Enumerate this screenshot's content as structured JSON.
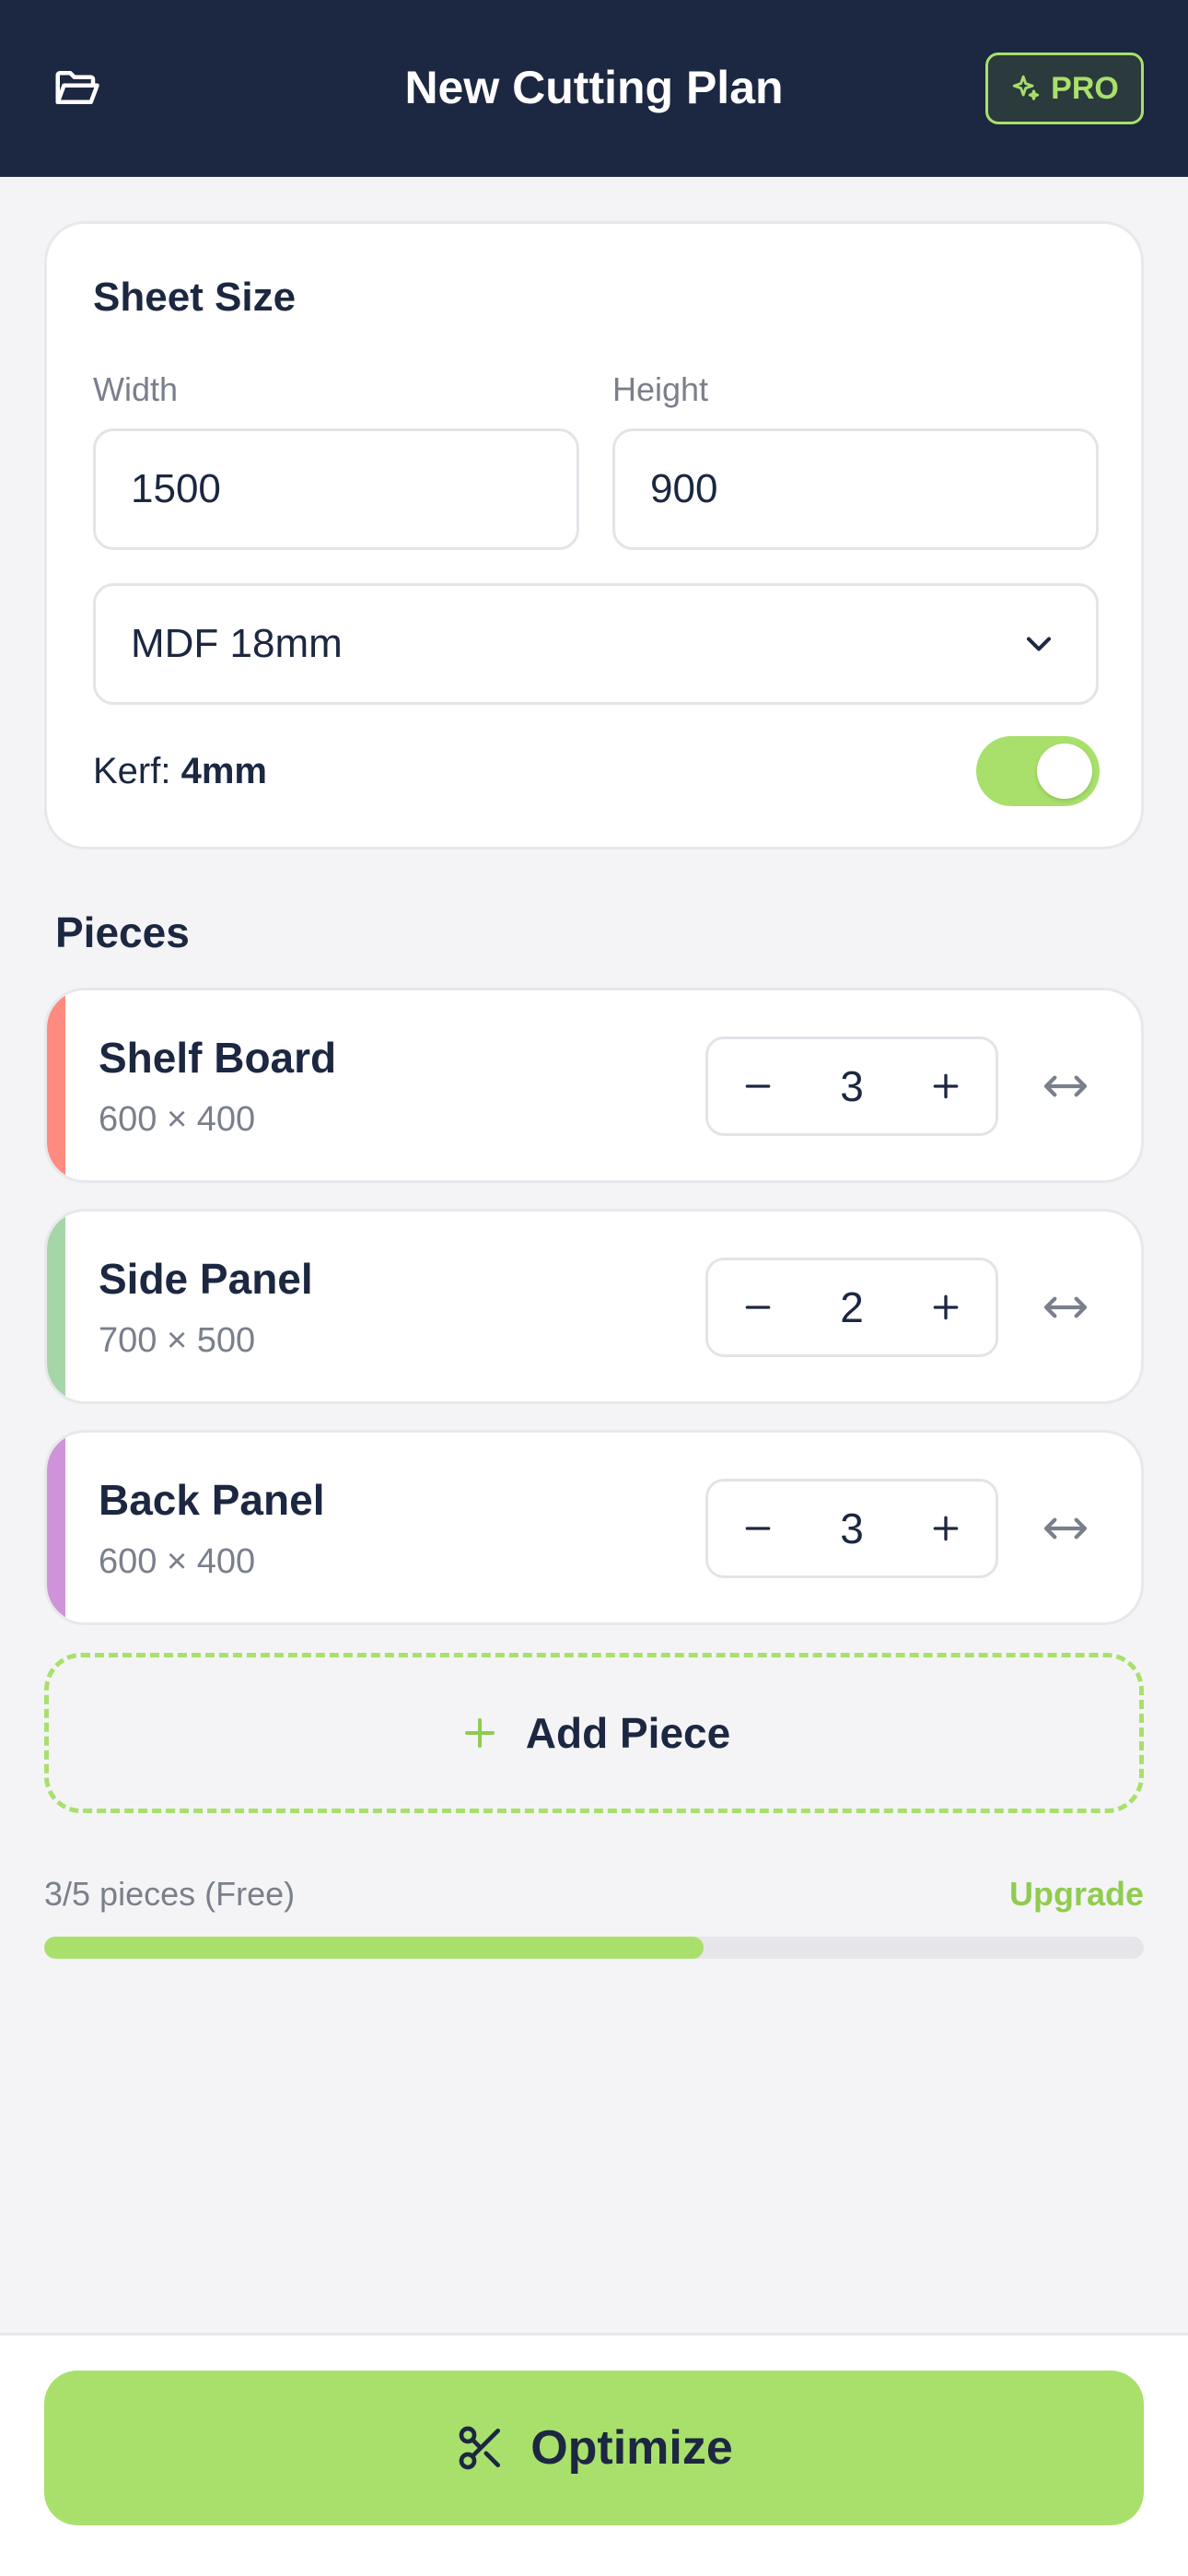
{
  "header": {
    "title": "New Cutting Plan",
    "pro_label": "PRO"
  },
  "sheet": {
    "title": "Sheet Size",
    "width_label": "Width",
    "width_value": "1500",
    "height_label": "Height",
    "height_value": "900",
    "material": "MDF 18mm",
    "kerf_label": "Kerf:",
    "kerf_value": "4mm",
    "kerf_enabled": true
  },
  "pieces_title": "Pieces",
  "pieces": [
    {
      "name": "Shelf Board",
      "dims": "600 × 400",
      "qty": "3",
      "color": "#ff8a80"
    },
    {
      "name": "Side Panel",
      "dims": "700 × 500",
      "qty": "2",
      "color": "#a5d6a7"
    },
    {
      "name": "Back Panel",
      "dims": "600 × 400",
      "qty": "3",
      "color": "#ce93d8"
    }
  ],
  "add_piece_label": "Add Piece",
  "usage": {
    "text": "3/5 pieces (Free)",
    "upgrade_label": "Upgrade",
    "used": 3,
    "limit": 5
  },
  "optimize_label": "Optimize",
  "colors": {
    "navy": "#1c2741",
    "accent": "#a8e06b",
    "muted": "#7a7f8c"
  }
}
